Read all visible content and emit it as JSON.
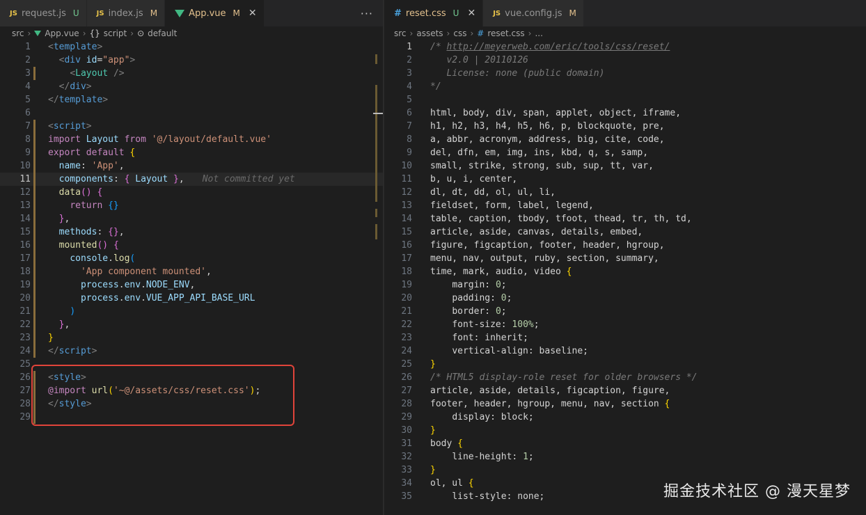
{
  "left": {
    "tabs": [
      {
        "icon": "js",
        "label": "request.js",
        "status": "U"
      },
      {
        "icon": "js",
        "label": "index.js",
        "status": "M"
      },
      {
        "icon": "vue",
        "label": "App.vue",
        "status": "M"
      }
    ],
    "more": "···",
    "breadcrumb": [
      "src",
      "App.vue",
      "script",
      "default"
    ],
    "ghost_text": "Not committed yet"
  },
  "right": {
    "tabs": [
      {
        "icon": "css",
        "label": "reset.css",
        "status": "U"
      },
      {
        "icon": "js",
        "label": "vue.config.js",
        "status": "M"
      }
    ],
    "breadcrumb": [
      "src",
      "assets",
      "css",
      "reset.css",
      "..."
    ]
  },
  "watermark": "掘金技术社区 @ 漫天星梦",
  "colors": {
    "accent_modified": "#e2c08d",
    "accent_untracked": "#73c991",
    "highlight": "#e0443a"
  }
}
